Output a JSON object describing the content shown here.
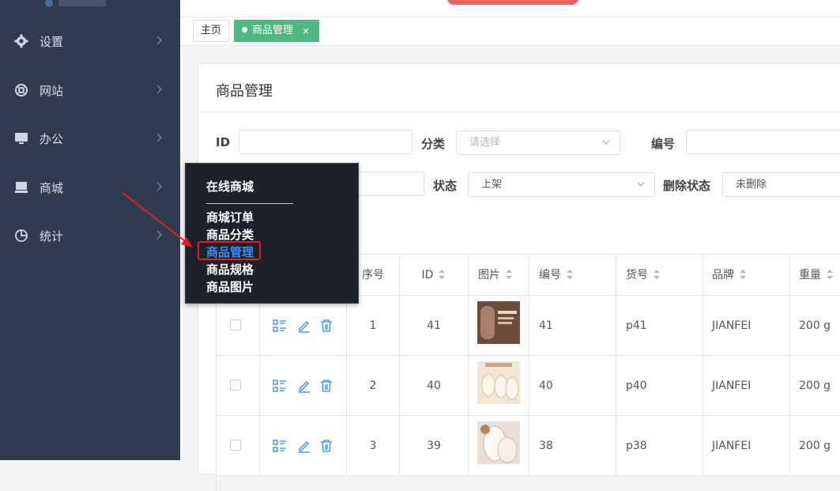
{
  "sidebar": {
    "items": [
      {
        "label": "设置",
        "icon": "gear-icon"
      },
      {
        "label": "网站",
        "icon": "lifebuoy-icon"
      },
      {
        "label": "办公",
        "icon": "monitor-icon"
      },
      {
        "label": "商城",
        "icon": "store-icon"
      },
      {
        "label": "统计",
        "icon": "pie-chart-icon"
      }
    ]
  },
  "tabs": {
    "home": "主页",
    "active": "商品管理",
    "close": "×"
  },
  "panel": {
    "title": "商品管理"
  },
  "filters": {
    "id_label": "ID",
    "category_label": "分类",
    "category_placeholder": "请选择",
    "code_label": "编号",
    "status_label": "状态",
    "status_value": "上架",
    "delete_status_label": "删除状态",
    "delete_status_value": "未删除"
  },
  "table": {
    "headers": {
      "seq": "序号",
      "id": "ID",
      "image": "图片",
      "code": "编号",
      "sku": "货号",
      "brand": "品牌",
      "weight": "重量"
    },
    "rows": [
      {
        "seq": "1",
        "id": "41",
        "code": "41",
        "sku": "p41",
        "brand": "JIANFEI",
        "weight": "200 g"
      },
      {
        "seq": "2",
        "id": "40",
        "code": "40",
        "sku": "p40",
        "brand": "JIANFEI",
        "weight": "200 g"
      },
      {
        "seq": "3",
        "id": "39",
        "code": "38",
        "sku": "p38",
        "brand": "JIANFEI",
        "weight": "200 g"
      }
    ]
  },
  "popup": {
    "title": "在线商城",
    "items": [
      "商城订单",
      "商品分类",
      "商品管理",
      "商品规格",
      "商品图片"
    ]
  },
  "colors": {
    "sidebar": "#2f3c4f",
    "tab_active": "#4fb881",
    "popup_bg": "#1d2129",
    "selected_link": "#3b8cff",
    "annotation_red": "#e01f1f",
    "action_icon": "#2d8cf0"
  }
}
